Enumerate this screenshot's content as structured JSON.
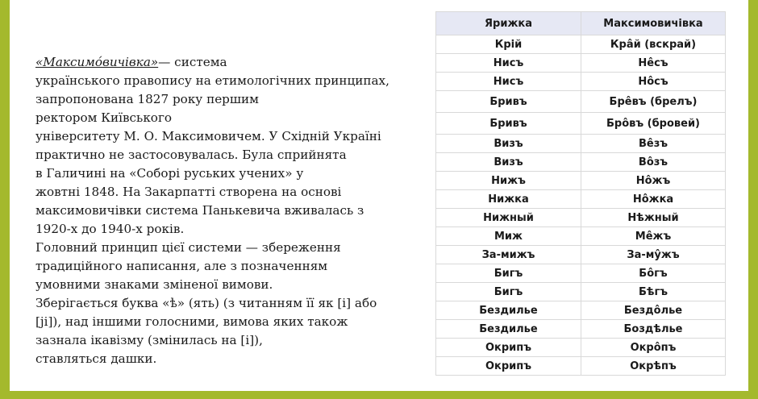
{
  "colors": {
    "frame": "#a4b92d",
    "table_header_bg": "#e6e8f4"
  },
  "article": {
    "title": "«Максимо́вичівка»",
    "body": "— система\nукраїнського правопису на етимологічних принципах,\nзапропонована 1827 року першим\nректором Київського\nуніверситету М. О. Максимовичем. У Східній Україні\nпрактично не застосовувалась. Була сприйнята\nв Галичині на «Соборі руських учених» у\nжовтні 1848. На Закарпатті створена на основі\nмаксимовичівки система Панькевича вживалась з\n1920-х до 1940-х років.\nГоловний принцип цієї системи — збереження\nтрадиційного написання, але з позначенням\nумовними знаками зміненої вимови.\nЗберігається буква «ѣ» (ять) (з читанням її як [і] або\n[ji]), над іншими голосними, вимова яких також\nзазнала ікавізму (змінилась на [і]),\nставляться дашки."
  },
  "table": {
    "headers": [
      "Ярижка",
      "Максимовичівка"
    ],
    "rows": [
      [
        "Крій",
        "Кра̂й (вскрай)"
      ],
      [
        "Нисъ",
        "Не̂съ"
      ],
      [
        "Нисъ",
        "Но̂съ"
      ],
      [
        "Бривъ",
        "Бре̂въ (брелъ)"
      ],
      [
        "Бривъ",
        "Бро̂въ (бровей)"
      ],
      [
        "Визъ",
        "Ве̂зъ"
      ],
      [
        "Визъ",
        "Во̂зъ"
      ],
      [
        "Нижъ",
        "Но̂жъ"
      ],
      [
        "Нижка",
        "Но̂жка"
      ],
      [
        "Нижный",
        "Нѣжный"
      ],
      [
        "Миж",
        "Ме̂жъ"
      ],
      [
        "За-мижъ",
        "За-му̂жъ"
      ],
      [
        "Бигъ",
        "Бо̂гъ"
      ],
      [
        "Бигъ",
        "Бѣгъ"
      ],
      [
        "Бездилье",
        "Бездо̂лье"
      ],
      [
        "Бездилье",
        "Боздѣлье"
      ],
      [
        "Окрипъ",
        "Окро̂пъ"
      ],
      [
        "Окрипъ",
        "Окрѣпъ"
      ]
    ]
  }
}
